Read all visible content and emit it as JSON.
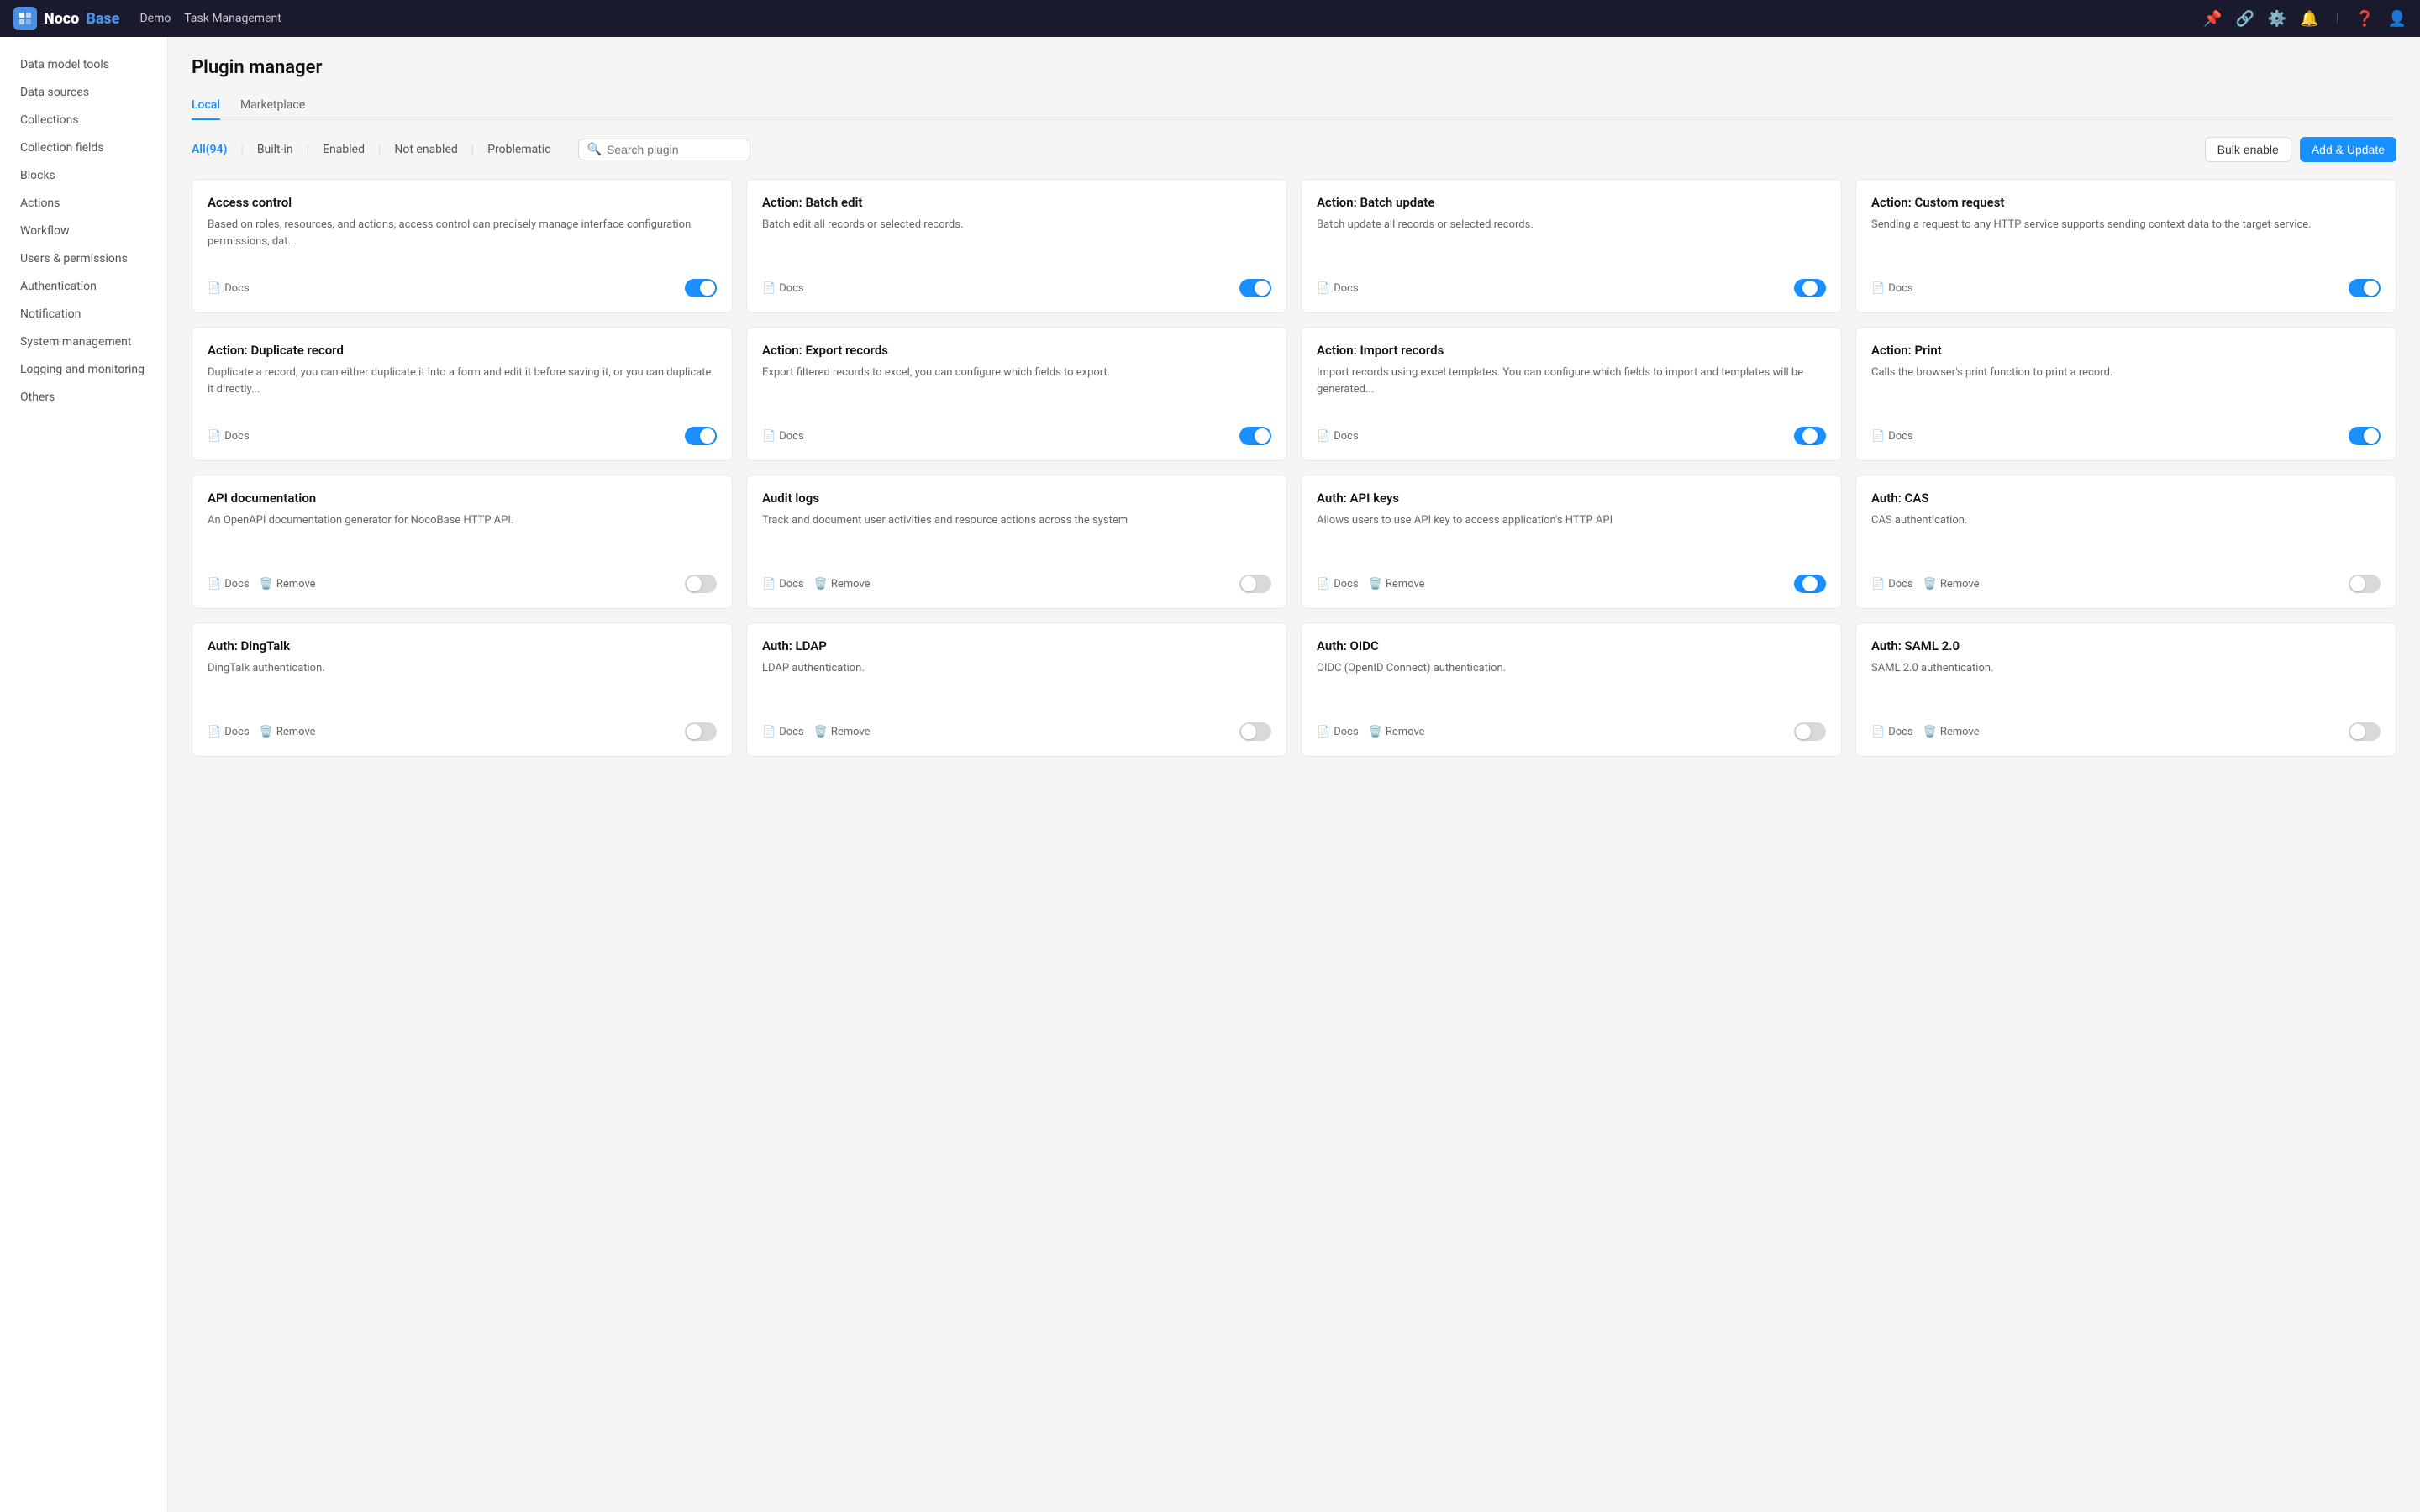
{
  "topnav": {
    "logo_noco": "Noco",
    "logo_base": "Base",
    "links": [
      "Demo",
      "Task Management"
    ],
    "icons": [
      "pin-icon",
      "branch-icon",
      "settings-icon",
      "bell-icon",
      "divider",
      "help-icon",
      "user-icon"
    ]
  },
  "sidebar": {
    "items": [
      {
        "id": "data-model-tools",
        "label": "Data model tools",
        "active": false
      },
      {
        "id": "data-sources",
        "label": "Data sources",
        "active": false
      },
      {
        "id": "collections",
        "label": "Collections",
        "active": false
      },
      {
        "id": "collection-fields",
        "label": "Collection fields",
        "active": false
      },
      {
        "id": "blocks",
        "label": "Blocks",
        "active": false
      },
      {
        "id": "actions",
        "label": "Actions",
        "active": false
      },
      {
        "id": "workflow",
        "label": "Workflow",
        "active": false
      },
      {
        "id": "users-permissions",
        "label": "Users & permissions",
        "active": false
      },
      {
        "id": "authentication",
        "label": "Authentication",
        "active": false
      },
      {
        "id": "notification",
        "label": "Notification",
        "active": false
      },
      {
        "id": "system-management",
        "label": "System management",
        "active": false
      },
      {
        "id": "logging-monitoring",
        "label": "Logging and monitoring",
        "active": false
      },
      {
        "id": "others",
        "label": "Others",
        "active": false
      }
    ]
  },
  "page": {
    "title": "Plugin manager"
  },
  "tabs": [
    {
      "id": "local",
      "label": "Local",
      "active": true
    },
    {
      "id": "marketplace",
      "label": "Marketplace",
      "active": false
    }
  ],
  "filters": {
    "options": [
      {
        "id": "all",
        "label": "All(94)",
        "active": true
      },
      {
        "id": "built-in",
        "label": "Built-in",
        "active": false
      },
      {
        "id": "enabled",
        "label": "Enabled",
        "active": false
      },
      {
        "id": "not-enabled",
        "label": "Not enabled",
        "active": false
      },
      {
        "id": "problematic",
        "label": "Problematic",
        "active": false
      }
    ],
    "search_placeholder": "Search plugin",
    "bulk_enable_label": "Bulk enable",
    "add_update_label": "Add & Update"
  },
  "plugins": [
    {
      "id": "access-control",
      "title": "Access control",
      "desc": "Based on roles, resources, and actions, access control can precisely manage interface configuration permissions, dat...",
      "docs": "Docs",
      "has_remove": false,
      "enabled": true,
      "toggle_state": "on"
    },
    {
      "id": "action-batch-edit",
      "title": "Action: Batch edit",
      "desc": "Batch edit all records or selected records.",
      "docs": "Docs",
      "has_remove": false,
      "enabled": true,
      "toggle_state": "on"
    },
    {
      "id": "action-batch-update",
      "title": "Action: Batch update",
      "desc": "Batch update all records or selected records.",
      "docs": "Docs",
      "has_remove": false,
      "enabled": true,
      "toggle_state": "half"
    },
    {
      "id": "action-custom-request",
      "title": "Action: Custom request",
      "desc": "Sending a request to any HTTP service supports sending context data to the target service.",
      "docs": "Docs",
      "has_remove": false,
      "enabled": true,
      "toggle_state": "on"
    },
    {
      "id": "action-duplicate-record",
      "title": "Action: Duplicate record",
      "desc": "Duplicate a record, you can either duplicate it into a form and edit it before saving it, or you can duplicate it directly...",
      "docs": "Docs",
      "has_remove": false,
      "enabled": true,
      "toggle_state": "on"
    },
    {
      "id": "action-export-records",
      "title": "Action: Export records",
      "desc": "Export filtered records to excel, you can configure which fields to export.",
      "docs": "Docs",
      "has_remove": false,
      "enabled": true,
      "toggle_state": "on"
    },
    {
      "id": "action-import-records",
      "title": "Action: Import records",
      "desc": "Import records using excel templates. You can configure which fields to import and templates will be generated...",
      "docs": "Docs",
      "has_remove": false,
      "enabled": true,
      "toggle_state": "half"
    },
    {
      "id": "action-print",
      "title": "Action: Print",
      "desc": "Calls the browser's print function to print a record.",
      "docs": "Docs",
      "has_remove": false,
      "enabled": true,
      "toggle_state": "on"
    },
    {
      "id": "api-documentation",
      "title": "API documentation",
      "desc": "An OpenAPI documentation generator for NocoBase HTTP API.",
      "docs": "Docs",
      "remove": "Remove",
      "has_remove": true,
      "enabled": false,
      "toggle_state": "off"
    },
    {
      "id": "audit-logs",
      "title": "Audit logs",
      "desc": "Track and document user activities and resource actions across the system",
      "docs": "Docs",
      "remove": "Remove",
      "has_remove": true,
      "enabled": false,
      "toggle_state": "off"
    },
    {
      "id": "auth-api-keys",
      "title": "Auth: API keys",
      "desc": "Allows users to use API key to access application's HTTP API",
      "docs": "Docs",
      "remove": "Remove",
      "has_remove": true,
      "enabled": false,
      "toggle_state": "half"
    },
    {
      "id": "auth-cas",
      "title": "Auth: CAS",
      "desc": "CAS authentication.",
      "docs": "Docs",
      "remove": "Remove",
      "has_remove": true,
      "enabled": false,
      "toggle_state": "off"
    },
    {
      "id": "auth-dingtalk",
      "title": "Auth: DingTalk",
      "desc": "DingTalk authentication.",
      "docs": "Docs",
      "remove": "Remove",
      "has_remove": true,
      "enabled": false,
      "toggle_state": "off"
    },
    {
      "id": "auth-ldap",
      "title": "Auth: LDAP",
      "desc": "LDAP authentication.",
      "docs": "Docs",
      "remove": "Remove",
      "has_remove": true,
      "enabled": false,
      "toggle_state": "off"
    },
    {
      "id": "auth-oidc",
      "title": "Auth: OIDC",
      "desc": "OIDC (OpenID Connect) authentication.",
      "docs": "Docs",
      "remove": "Remove",
      "has_remove": true,
      "enabled": false,
      "toggle_state": "off"
    },
    {
      "id": "auth-saml",
      "title": "Auth: SAML 2.0",
      "desc": "SAML 2.0 authentication.",
      "docs": "Docs",
      "remove": "Remove",
      "has_remove": true,
      "enabled": false,
      "toggle_state": "off"
    }
  ]
}
